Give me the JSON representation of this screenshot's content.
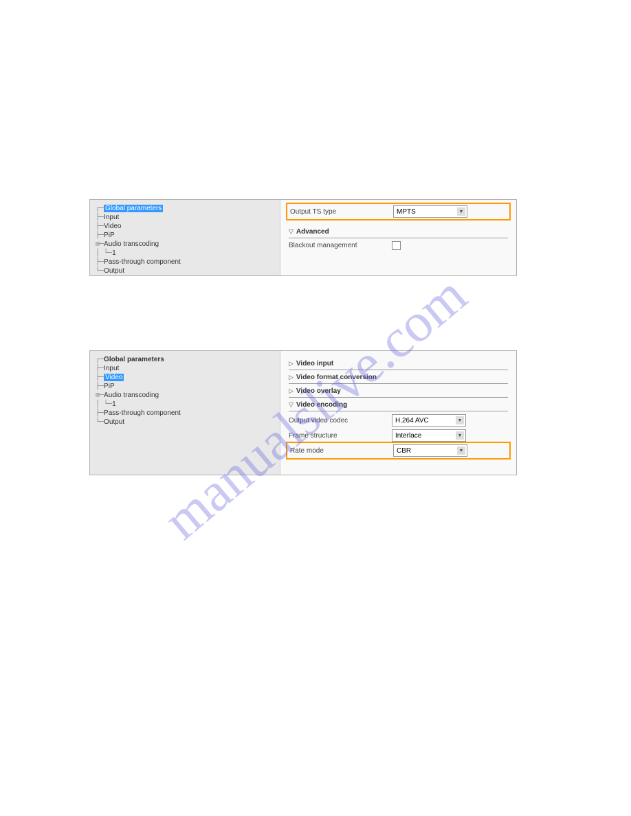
{
  "watermark": "manualslive.com",
  "panel1": {
    "tree": [
      {
        "prefix": "┌─",
        "label": "Global parameters",
        "highlighted": true
      },
      {
        "prefix": "├─",
        "label": "Input"
      },
      {
        "prefix": "├─",
        "label": "Video"
      },
      {
        "prefix": "├─",
        "label": "PiP"
      },
      {
        "prefix": "⊞─",
        "label": "Audio transcoding"
      },
      {
        "prefix": "│  └─",
        "label": "1"
      },
      {
        "prefix": "├─",
        "label": "Pass-through component"
      },
      {
        "prefix": "└─",
        "label": "Output"
      }
    ],
    "output_ts_label": "Output TS type",
    "output_ts_value": "MPTS",
    "advanced_label": "Advanced",
    "blackout_label": "Blackout management"
  },
  "panel2": {
    "tree": [
      {
        "prefix": "┌─",
        "label": "Global parameters",
        "bold": true
      },
      {
        "prefix": "├─",
        "label": "Input"
      },
      {
        "prefix": "├─",
        "label": "Video",
        "highlighted": true
      },
      {
        "prefix": "├─",
        "label": "PiP"
      },
      {
        "prefix": "⊞─",
        "label": "Audio transcoding"
      },
      {
        "prefix": "│  └─",
        "label": "1"
      },
      {
        "prefix": "├─",
        "label": "Pass-through component"
      },
      {
        "prefix": "└─",
        "label": "Output"
      }
    ],
    "sections": {
      "video_input": "Video input",
      "video_format": "Video format conversion",
      "video_overlay": "Video overlay",
      "video_encoding": "Video encoding"
    },
    "output_codec_label": "Output video codec",
    "output_codec_value": "H.264 AVC",
    "frame_structure_label": "Frame structure",
    "frame_structure_value": "Interlace",
    "rate_mode_label": "Rate mode",
    "rate_mode_value": "CBR"
  }
}
